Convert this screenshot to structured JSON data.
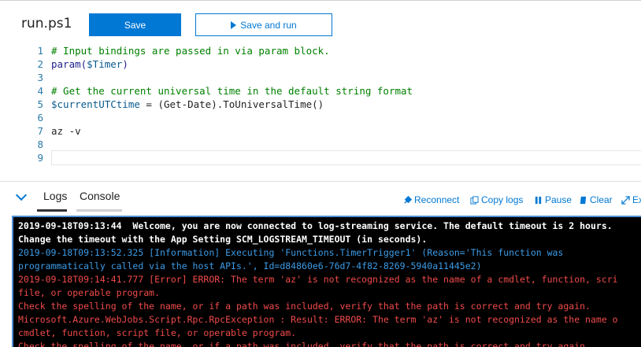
{
  "editor": {
    "file_name": "run.ps1",
    "save_label": "Save",
    "save_and_run_label": "Save and run",
    "lines": [
      {
        "n": "1",
        "segments": [
          {
            "t": "# Input bindings are passed in via param block.",
            "c": "cm"
          }
        ]
      },
      {
        "n": "2",
        "segments": [
          {
            "t": "param(",
            "c": "kw"
          },
          {
            "t": "$Timer",
            "c": "var"
          },
          {
            "t": ")",
            "c": "kw"
          }
        ]
      },
      {
        "n": "3",
        "segments": []
      },
      {
        "n": "4",
        "segments": [
          {
            "t": "# Get the current universal time in the default string format",
            "c": "cm"
          }
        ]
      },
      {
        "n": "5",
        "segments": [
          {
            "t": "$currentUTCtime",
            "c": "var"
          },
          {
            "t": " = (Get-Date).ToUniversalTime()",
            "c": "pl"
          }
        ]
      },
      {
        "n": "6",
        "segments": []
      },
      {
        "n": "7",
        "segments": [
          {
            "t": "az -v",
            "c": "pl"
          }
        ]
      },
      {
        "n": "8",
        "segments": []
      },
      {
        "n": "9",
        "segments": []
      }
    ]
  },
  "log_panel": {
    "tabs": [
      "Logs",
      "Console"
    ],
    "active_tab": "Logs",
    "actions": {
      "reconnect": "Reconnect",
      "copy_logs": "Copy logs",
      "pause": "Pause",
      "clear": "Clear",
      "expand": "Ex"
    },
    "lines": [
      {
        "t": "2019-09-18T09:13:44  Welcome, you are now connected to log-streaming service. The default timeout is 2 hours.",
        "c": "c-white"
      },
      {
        "t": "Change the timeout with the App Setting SCM_LOGSTREAM_TIMEOUT (in seconds).",
        "c": "c-white"
      },
      {
        "t": "2019-09-18T09:13:52.325 [Information] Executing 'Functions.TimerTrigger1' (Reason='This function was",
        "c": "c-blue"
      },
      {
        "t": "programmatically called via the host APIs.', Id=d84860e6-76d7-4f82-8269-5940a11445e2)",
        "c": "c-blue"
      },
      {
        "t": "2019-09-18T09:14:41.777 [Error] ERROR: The term 'az' is not recognized as the name of a cmdlet, function, scri",
        "c": "c-red"
      },
      {
        "t": "file, or operable program.",
        "c": "c-red"
      },
      {
        "t": "Check the spelling of the name, or if a path was included, verify that the path is correct and try again.",
        "c": "c-red"
      },
      {
        "t": "Microsoft.Azure.WebJobs.Script.Rpc.RpcException : Result: ERROR: The term 'az' is not recognized as the name o",
        "c": "c-red"
      },
      {
        "t": "cmdlet, function, script file, or operable program.",
        "c": "c-red"
      },
      {
        "t": "Check the spelling of the name, or if a path was included, verify that the path is correct and try again.",
        "c": "c-red"
      }
    ]
  },
  "colors": {
    "accent": "#0078d4",
    "console_bg": "#000000",
    "info": "#3c9be6",
    "error": "#f04a4a"
  }
}
